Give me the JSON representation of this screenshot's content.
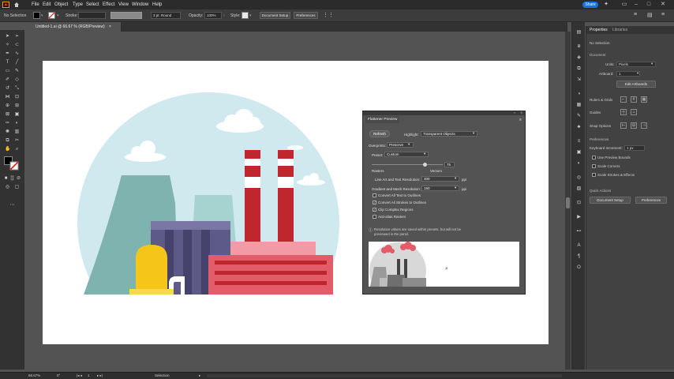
{
  "menu": {
    "app_logo": "Ai",
    "items": [
      "File",
      "Edit",
      "Object",
      "Type",
      "Select",
      "Effect",
      "View",
      "Window",
      "Help"
    ],
    "share_label": "Share"
  },
  "control_bar": {
    "selection_label": "No Selection",
    "stroke_label": "Stroke:",
    "brush_label": "3 pt. Round",
    "opacity_label": "Opacity:",
    "opacity_value": "100%",
    "style_label": "Style:",
    "document_setup_label": "Document Setup",
    "preferences_label": "Preferences"
  },
  "document_tab": {
    "title": "Untitled-1.ai @ 66.67 % (RGB/Preview)",
    "close": "×"
  },
  "properties_panel": {
    "tabs": [
      "Properties",
      "Libraries"
    ],
    "no_selection": "No Selection",
    "document_heading": "Document",
    "units_label": "Units:",
    "units_value": "Pixels",
    "artboard_label": "Artboard:",
    "artboard_value": "1",
    "edit_artboards_label": "Edit Artboards",
    "rulers_label": "Rulers & Grids",
    "guides_label": "Guides",
    "snap_label": "Snap Options",
    "preferences_heading": "Preferences",
    "keyboard_increment_label": "Keyboard Increment:",
    "keyboard_increment_value": "1 px",
    "checkboxes": [
      "Use Preview Bounds",
      "Scale Corners",
      "Scale Strokes & Effects"
    ],
    "quick_actions_heading": "Quick Actions",
    "document_setup_button": "Document Setup",
    "preferences_button": "Preferences"
  },
  "flattener": {
    "title": "Flattener Preview",
    "refresh_label": "Refresh",
    "highlight_label": "Highlight:",
    "highlight_value": "Transparent Objects",
    "overprints_label": "Overprints:",
    "overprints_value": "Preserve",
    "preset_label": "Preset:",
    "preset_value": "Custom",
    "slider_value": "75",
    "rasters_label": "Rasters",
    "vectors_label": "Vectors",
    "slider_fraction": 0.75,
    "line_art_label": "Line Art and Text Resolution:",
    "line_art_value": "300",
    "gradient_label": "Gradient and Mesh Resolution:",
    "gradient_value": "150",
    "ppi_unit": "ppi",
    "options": [
      {
        "label": "Convert All Text to Outlines",
        "checked": false
      },
      {
        "label": "Convert All Strokes to Outlines",
        "checked": true
      },
      {
        "label": "Clip Complex Regions",
        "checked": true
      },
      {
        "label": "Anti-alias Rasters",
        "checked": false
      }
    ],
    "note": "Resolution values are saved within presets, but will not be previewed in the panel."
  },
  "status_bar": {
    "zoom": "66.67%",
    "angle": "0°",
    "artboard_nav": "1",
    "tool_name": "Selection"
  },
  "colors": {
    "sky_circle": "#cfe9ee",
    "cooling_tower": "#7fb3b0",
    "cooling_tower_light": "#a6d2cf",
    "building_purple": "#5d5a87",
    "tank_yellow": "#f5c518",
    "factory_red": "#e25c6a",
    "factory_pink": "#f29aa5",
    "chimney_red": "#c0262e",
    "accent_blue": "#1473e6"
  }
}
